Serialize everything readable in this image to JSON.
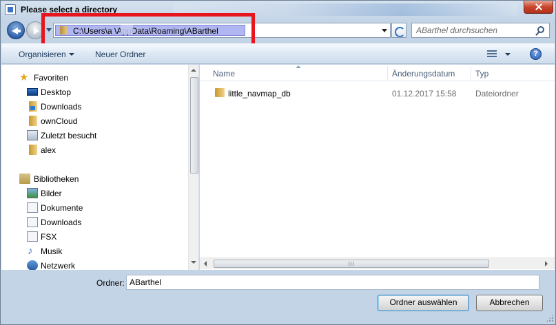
{
  "window": {
    "title": "Please select a directory"
  },
  "address": {
    "path": "C:\\Users\\a     \\AppData\\Roaming\\ABarthel"
  },
  "search": {
    "placeholder": "ABarthel durchsuchen"
  },
  "toolbar": {
    "organize_label": "Organisieren",
    "new_folder_label": "Neuer Ordner",
    "help_label": "?"
  },
  "sidebar": {
    "favorites_label": "Favoriten",
    "favorites": [
      {
        "label": "Desktop",
        "icon": "desktop-icon"
      },
      {
        "label": "Downloads",
        "icon": "downloads-folder-icon"
      },
      {
        "label": "ownCloud",
        "icon": "folder-icon"
      },
      {
        "label": "Zuletzt besucht",
        "icon": "recent-places-icon"
      },
      {
        "label": "alex",
        "icon": "folder-icon"
      }
    ],
    "libraries_label": "Bibliotheken",
    "libraries": [
      {
        "label": "Bilder",
        "icon": "pictures-icon"
      },
      {
        "label": "Dokumente",
        "icon": "documents-icon"
      },
      {
        "label": "Downloads",
        "icon": "downloads-icon"
      },
      {
        "label": "FSX",
        "icon": "library-icon"
      },
      {
        "label": "Musik",
        "icon": "music-icon"
      }
    ],
    "network_label": "Netzwerk"
  },
  "columns": {
    "name": "Name",
    "date": "Änderungsdatum",
    "type": "Typ"
  },
  "files": [
    {
      "name": "little_navmap_db",
      "date": "01.12.2017 15:58",
      "type": "Dateiordner"
    }
  ],
  "footer": {
    "folder_label": "Ordner:",
    "folder_value": "ABarthel",
    "select_label": "Ordner auswählen",
    "cancel_label": "Abbrechen"
  },
  "colors": {
    "highlight_box": "#e8141e",
    "selection": "#b0b6f0",
    "accent": "#3b74c3"
  }
}
